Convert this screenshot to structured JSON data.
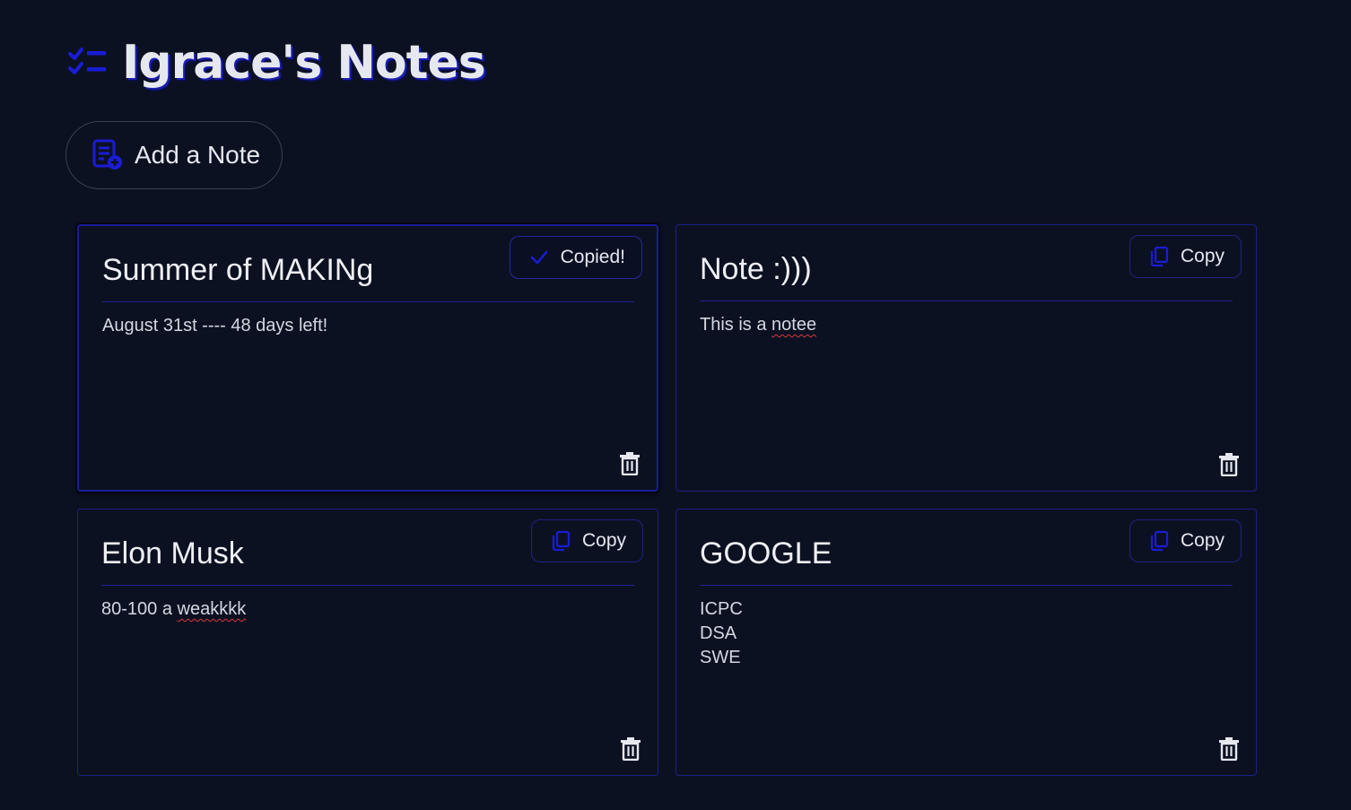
{
  "header": {
    "title": "Igrace's Notes",
    "icon": "checklist-icon"
  },
  "add_button": {
    "label": "Add a Note",
    "icon": "note-add-icon"
  },
  "colors": {
    "background": "#0c1122",
    "accent": "#1a1cd6",
    "card_border": "#1c1f86",
    "spellcheck": "#d83a3a"
  },
  "notes": [
    {
      "title": "Summer of MAKINg",
      "body": "August 31st ---- 48 days left!",
      "copy_label": "Copied!",
      "copy_icon": "check-icon",
      "state": "copied"
    },
    {
      "title": "Note :)))",
      "body_prefix": "This is a ",
      "body_misspelled": "notee",
      "copy_label": "Copy",
      "copy_icon": "copy-icon",
      "state": "idle"
    },
    {
      "title": "Elon Musk",
      "body_prefix": "80-100 a ",
      "body_misspelled": "weakkkk",
      "copy_label": "Copy",
      "copy_icon": "copy-icon",
      "state": "idle"
    },
    {
      "title": "GOOGLE",
      "body": "ICPC\nDSA\nSWE",
      "copy_label": "Copy",
      "copy_icon": "copy-icon",
      "state": "idle"
    }
  ]
}
